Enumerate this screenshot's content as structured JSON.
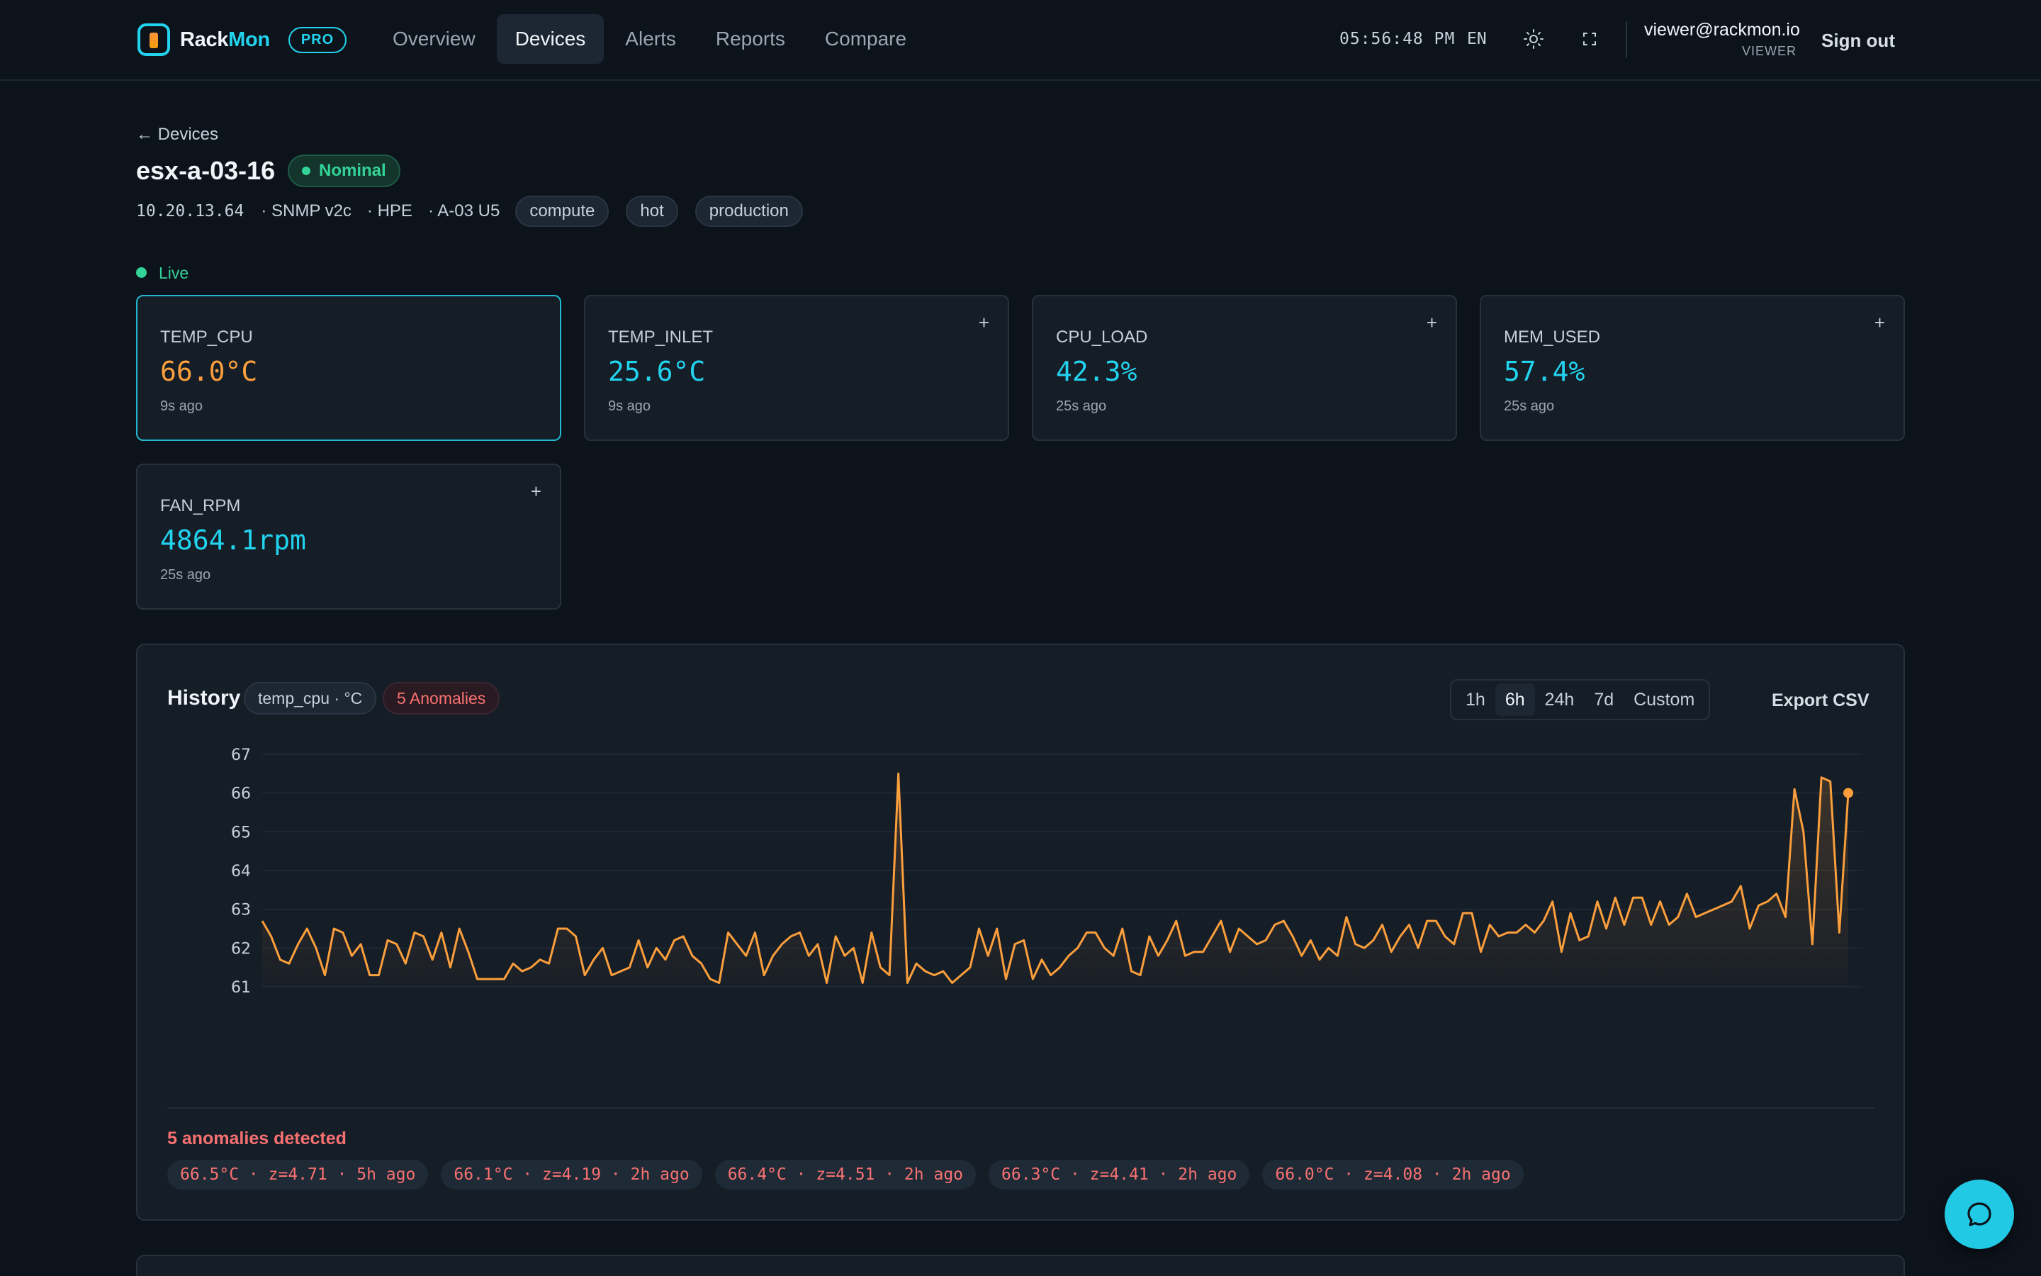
{
  "brand": {
    "name_part1": "Rack",
    "name_part2": "Mon",
    "badge": "PRO"
  },
  "nav": {
    "items": [
      "Overview",
      "Devices",
      "Alerts",
      "Reports",
      "Compare"
    ],
    "active": "Devices"
  },
  "topbar": {
    "clock": "05:56:48 PM",
    "language": "EN",
    "theme_icon": "sun-icon",
    "fullscreen_icon": "fullscreen-icon",
    "user_email": "viewer@rackmon.io",
    "user_role": "VIEWER",
    "signout_label": "Sign out"
  },
  "device": {
    "back_label": "← Devices",
    "name": "esx-a-03-16",
    "status": "Nominal",
    "ip": "10.20.13.64",
    "protocol": "· SNMP v2c",
    "vendor": "· HPE",
    "location": "· A-03 U5",
    "tags": [
      "compute",
      "hot",
      "production"
    ]
  },
  "live_label": "Live",
  "metrics": [
    {
      "label": "TEMP_CPU",
      "value": "66.0°C",
      "age": "9s ago",
      "color": "#fb9e3c",
      "selected": true
    },
    {
      "label": "TEMP_INLET",
      "value": "25.6°C",
      "age": "9s ago",
      "color": "#22d3ee",
      "plus": "+"
    },
    {
      "label": "CPU_LOAD",
      "value": "42.3%",
      "age": "25s ago",
      "color": "#22d3ee",
      "plus": "+"
    },
    {
      "label": "MEM_USED",
      "value": "57.4%",
      "age": "25s ago",
      "color": "#22d3ee",
      "plus": "+"
    },
    {
      "label": "FAN_RPM",
      "value": "4864.1rpm",
      "age": "25s ago",
      "color": "#22d3ee",
      "plus": "+"
    }
  ],
  "history": {
    "title": "History",
    "metric_chip": "temp_cpu · °C",
    "anomaly_chip": "5 Anomalies",
    "ranges": [
      "1h",
      "6h",
      "24h",
      "7d",
      "Custom"
    ],
    "active_range": "6h",
    "export_label": "Export CSV",
    "anomalies_title": "5 anomalies detected",
    "anomalies": [
      "66.5°C · z=4.71 · 5h ago",
      "66.1°C · z=4.19 · 2h ago",
      "66.4°C · z=4.51 · 2h ago",
      "66.3°C · z=4.41 · 2h ago",
      "66.0°C · z=4.08 · 2h ago"
    ]
  },
  "chart_data": {
    "type": "line",
    "title": "",
    "xlabel": "",
    "ylabel": "",
    "yticks": [
      61,
      62,
      63,
      64,
      65,
      66,
      67
    ],
    "ylim": [
      61,
      67
    ],
    "grid": true,
    "line_color": "#fb9e3c",
    "series": [
      {
        "values": [
          62.7,
          62.3,
          61.7,
          61.6,
          62.1,
          62.5,
          62.0,
          61.3,
          62.5,
          62.4,
          61.8,
          62.1,
          61.3,
          61.3,
          62.2,
          62.1,
          61.6,
          62.4,
          62.3,
          61.7,
          62.4,
          61.5,
          62.5,
          61.9,
          61.2,
          61.2,
          61.2,
          61.2,
          61.6,
          61.4,
          61.5,
          61.7,
          61.6,
          62.5,
          62.5,
          62.3,
          61.3,
          61.7,
          62.0,
          61.3,
          61.4,
          61.5,
          62.2,
          61.5,
          62.0,
          61.7,
          62.2,
          62.3,
          61.8,
          61.6,
          61.2,
          61.1,
          62.4,
          62.1,
          61.8,
          62.4,
          61.3,
          61.8,
          62.1,
          62.3,
          62.4,
          61.8,
          62.1,
          61.1,
          62.3,
          61.8,
          62.0,
          61.1,
          62.4,
          61.5,
          61.3,
          66.5,
          61.1,
          61.6,
          61.4,
          61.3,
          61.4,
          61.1,
          61.3,
          61.5,
          62.5,
          61.8,
          62.5,
          61.2,
          62.1,
          62.2,
          61.2,
          61.7,
          61.3,
          61.5,
          61.8,
          62.0,
          62.4,
          62.4,
          62.0,
          61.8,
          62.5,
          61.4,
          61.3,
          62.3,
          61.8,
          62.2,
          62.7,
          61.8,
          61.9,
          61.9,
          62.3,
          62.7,
          61.9,
          62.5,
          62.3,
          62.1,
          62.2,
          62.6,
          62.7,
          62.3,
          61.8,
          62.2,
          61.7,
          62.0,
          61.8,
          62.8,
          62.1,
          62.0,
          62.2,
          62.6,
          61.9,
          62.3,
          62.6,
          62.0,
          62.7,
          62.7,
          62.3,
          62.1,
          62.9,
          62.9,
          61.9,
          62.6,
          62.3,
          62.4,
          62.4,
          62.6,
          62.4,
          62.7,
          63.2,
          61.9,
          62.9,
          62.2,
          62.3,
          63.2,
          62.5,
          63.3,
          62.6,
          63.3,
          63.3,
          62.6,
          63.2,
          62.6,
          62.8,
          63.4,
          62.8,
          62.9,
          63.0,
          63.1,
          63.2,
          63.6,
          62.5,
          63.1,
          63.2,
          63.4,
          62.8,
          66.1,
          65.0,
          62.1,
          66.4,
          66.3,
          62.4,
          66.0
        ]
      }
    ]
  }
}
